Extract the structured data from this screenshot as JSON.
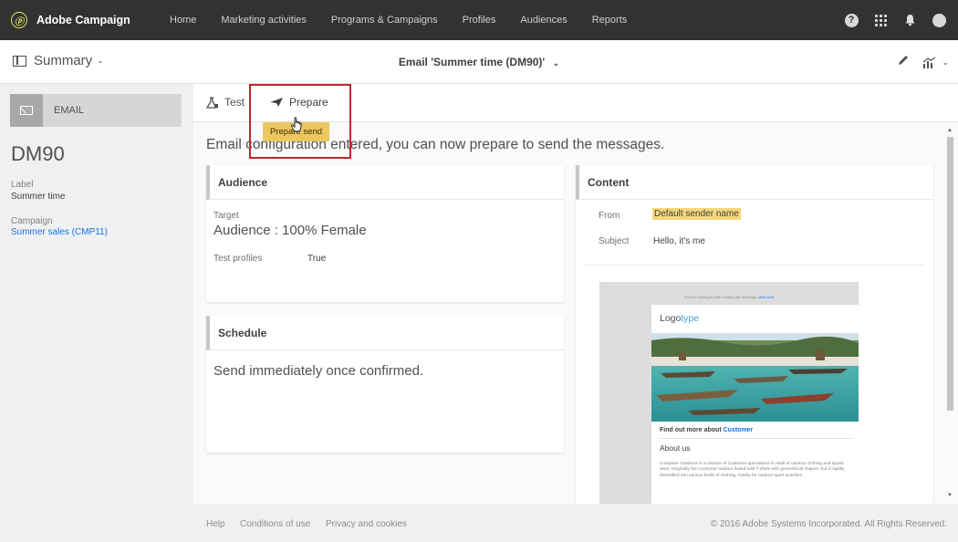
{
  "app": {
    "title": "Adobe Campaign",
    "logo_glyph": "ⓟ"
  },
  "nav": {
    "items": [
      {
        "label": "Home"
      },
      {
        "label": "Marketing activities"
      },
      {
        "label": "Programs & Campaigns"
      },
      {
        "label": "Profiles"
      },
      {
        "label": "Audiences"
      },
      {
        "label": "Reports"
      }
    ],
    "help_glyph": "?"
  },
  "header": {
    "summary_label": "Summary",
    "chevron": "⌄",
    "doc_title": "Email 'Summer time (DM90)'"
  },
  "sidebar": {
    "type_label": "EMAIL",
    "code": "DM90",
    "label_caption": "Label",
    "label_value": "Summer time",
    "campaign_caption": "Campaign",
    "campaign_value": "Summer sales (CMP11)"
  },
  "toolbar": {
    "test_label": "Test",
    "prepare_label": "Prepare",
    "tooltip": "Prepare send"
  },
  "main": {
    "intro": "Email configuration entered, you can now prepare to send the messages.",
    "audience": {
      "title": "Audience",
      "target_caption": "Target",
      "target_value": "Audience : 100% Female",
      "test_caption": "Test profiles",
      "test_value": "True"
    },
    "schedule": {
      "title": "Schedule",
      "text": "Send immediately once confirmed."
    },
    "content": {
      "title": "Content",
      "from_caption": "From",
      "from_value": "Default sender name",
      "subject_caption": "Subject",
      "subject_value": "Hello, it's me"
    },
    "preview": {
      "top_text": "If you're having trouble reading this message,",
      "top_link": "click here",
      "logo_a": "Logo",
      "logo_b": "type",
      "find_text": "Find out more about",
      "find_link": "Customer",
      "about_title": "About us",
      "about_text": "Customer Outdoors is a division of Customer specialized in retail of outdoor clothing and sports wear. Originally the Customer outdoor brand sold T-shirts with geometrical shapes, but it rapidly diversified into various kinds of clothing, mainly for outdoor sport activities."
    }
  },
  "footer": {
    "help": "Help",
    "conditions": "Conditions of use",
    "privacy": "Privacy and cookies",
    "copyright": "© 2016 Adobe Systems Incorporated. All Rights Reserved."
  },
  "colors": {
    "topbar": "#323232",
    "link": "#1473e6",
    "tooltip": "#ecc661",
    "highlight_box": "#c1272d"
  }
}
